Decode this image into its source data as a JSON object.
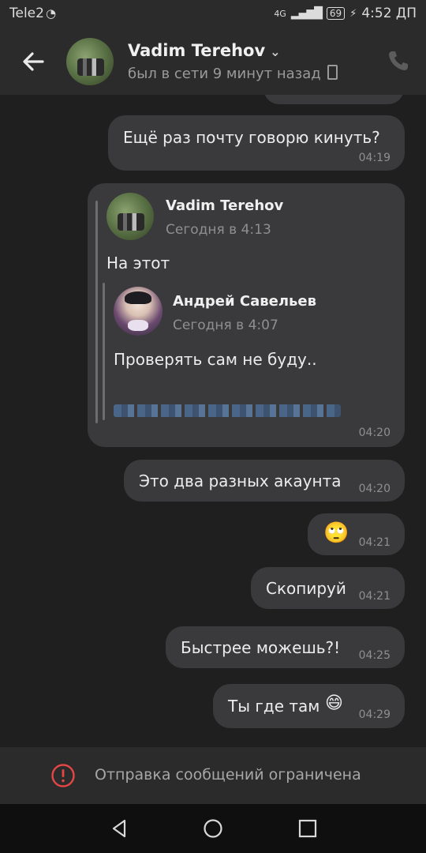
{
  "statusbar": {
    "carrier": "Tele2",
    "network": "4G",
    "battery": "69",
    "time": "4:52 ДП"
  },
  "header": {
    "name": "Vadim Terehov",
    "status": "был в сети 9 минут назад"
  },
  "messages": [
    {
      "text": "Ещё раз почту говорю кинуть?",
      "time": "04:19"
    },
    {
      "forward": {
        "name": "Vadim Terehov",
        "date": "Сегодня в 4:13",
        "text": "На этот",
        "nested": {
          "name": "Андрей Савельев",
          "date": "Сегодня в 4:07",
          "text": "Проверять сам не буду.."
        }
      },
      "time": "04:20"
    },
    {
      "text": "Это два разных акаунта",
      "time": "04:20"
    },
    {
      "emoji": "🙄",
      "time": "04:21"
    },
    {
      "text": "Скопируй",
      "time": "04:21"
    },
    {
      "text": "Быстрее можешь?!",
      "time": "04:25"
    },
    {
      "text": "Ты где там",
      "emoji": "😄",
      "time": "04:29"
    }
  ],
  "footer": {
    "text": "Отправка сообщений ограничена"
  },
  "icons": {
    "back": "arrow-left-icon",
    "call": "phone-icon",
    "warning": "alert-circle-icon",
    "nav_back": "triangle-back-icon",
    "nav_home": "circle-home-icon",
    "nav_recent": "square-recent-icon"
  },
  "colors": {
    "background": "#1f1f1f",
    "bubble": "#3a3a3c",
    "header": "#2b2b2c",
    "warning": "#e64646"
  }
}
